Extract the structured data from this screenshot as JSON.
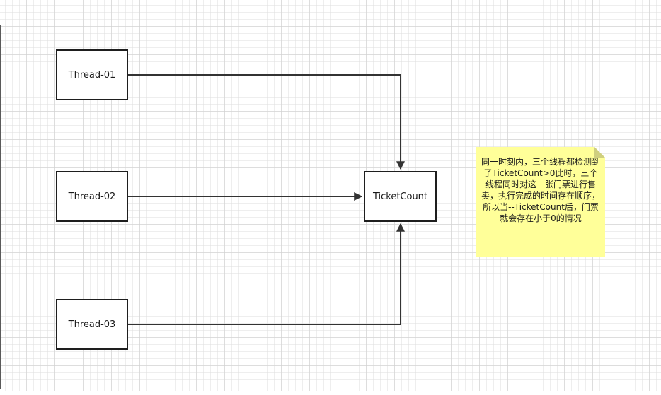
{
  "diagram": {
    "nodes": {
      "thread1": "Thread-01",
      "thread2": "Thread-02",
      "thread3": "Thread-03",
      "ticket": "TicketCount"
    },
    "note": "同一时刻内，三个线程都检测到了TicketCount>0此时，三个线程同时对这一张门票进行售卖，执行完成的时间存在顺序，所以当--TicketCount后，门票就会存在小于0的情况",
    "colors": {
      "node_border": "#1e1e1e",
      "edge": "#333333",
      "note_fill": "#ffff99",
      "note_fold": "#cfcf7f",
      "grid": "#d0d0d0"
    }
  }
}
